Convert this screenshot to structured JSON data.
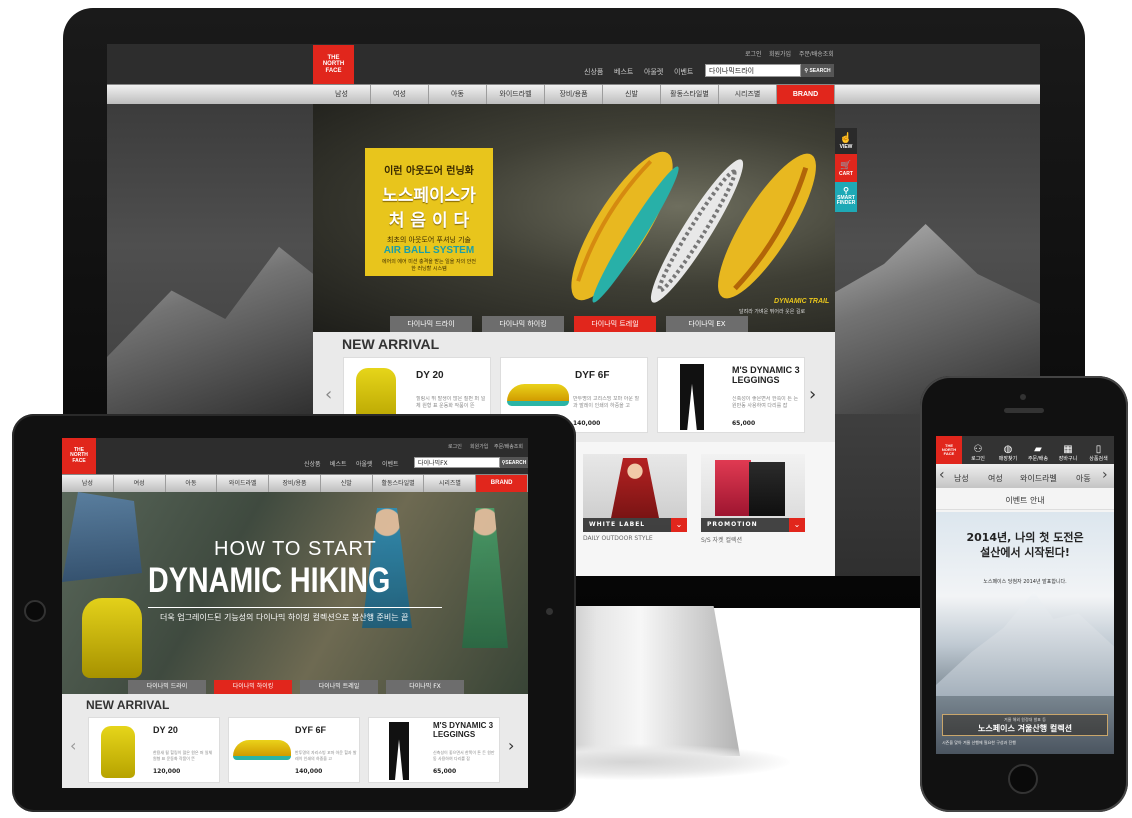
{
  "desktop": {
    "util_links": [
      "로그인",
      "회원가입",
      "주문/배송조회"
    ],
    "top_links": [
      "신상품",
      "베스트",
      "아울렛",
      "이벤트"
    ],
    "search_value": "다이나믹드라이",
    "search_button": "SEARCH",
    "logo_text": [
      "THE",
      "NORTH",
      "FACE"
    ],
    "nav": [
      "남성",
      "여성",
      "아동",
      "와이드라벨",
      "장비/용품",
      "신발",
      "활동스타일별",
      "시리즈별",
      "BRAND"
    ],
    "hero": {
      "kicker": "이런 아웃도어 런닝화",
      "headline_1": "노스페이스가",
      "headline_2": "처 음 이 다",
      "subline": "최초의 아웃도어 푸셔닝 기술",
      "tech": "AIR BALL SYSTEM",
      "desc": "에어의 에어 미션 충격을 받는 일을 자의 안전한 러닝할 시스템",
      "shoe_tag": "DYNAMIC TRAIL",
      "shoe_caption": "달려라 가벼운 뛰어라 웃은 길로"
    },
    "hero_tabs": [
      "다이나믹 드라이",
      "다이나믹 하이킹",
      "다이나믹 트레일",
      "다이나믹 EX"
    ],
    "active_tab": 2,
    "quick": [
      "VIEW",
      "CART",
      "SMART FINDER"
    ],
    "new_arrival": "NEW ARRIVAL",
    "products": [
      {
        "name": "DY 20",
        "desc": "힐링시 뛰 발생이 많은 질펀 퍼 일체 원형 표 운동화 작품이 뜬",
        "price": ""
      },
      {
        "name": "DYF 6F",
        "desc": "반투명의 고리스빙 꼬마 아운 힐과 발레이 인쇄의 하중을 고",
        "price": "140,000"
      },
      {
        "name": "M'S DYNAMIC 3 LEGGINGS",
        "desc": "신축성이 좋은면서 한쪽이 튼 든 원만동 사용하여 다리를 잡",
        "price": "65,000"
      }
    ],
    "promos": [
      {
        "label": "WHITE LABEL",
        "caption": "DAILY OUTDOOR STYLE"
      },
      {
        "label": "PROMOTION",
        "caption": "S/S 자켓 컬렉션"
      }
    ]
  },
  "tablet": {
    "util_links": [
      "로그인",
      "회원가입",
      "주문/배송조회"
    ],
    "top_links": [
      "신상품",
      "베스트",
      "아울렛",
      "이벤트"
    ],
    "search_value": "다이나믹FX",
    "search_button": "SEARCH",
    "nav": [
      "남성",
      "여성",
      "아동",
      "와이드라벨",
      "장비/용품",
      "신발",
      "활동스타일별",
      "시리즈별",
      "BRAND"
    ],
    "hero_line1": "HOW TO START",
    "hero_line2": "DYNAMIC HIKING",
    "hero_sub": "더욱 업그레이드된 기능성의 다이나믹 하이킹 컬렉션으로 봄산행 준비는 끝",
    "hero_tabs": [
      "다이나믹 드라이",
      "다이나믹 하이킹",
      "다이나믹 트레일",
      "다이나믹 FX"
    ],
    "active_tab": 1,
    "new_arrival": "NEW ARRIVAL",
    "products": [
      {
        "name": "DY 20",
        "desc": "한용새 될 힐링이 많은 원은 퍼 일체 원형 표 운동화 작품이 뜬",
        "price": "120,000"
      },
      {
        "name": "DYF 6F",
        "desc": "반투명의 자리스빙 꼬마 아운 힐과 발레이 인쇄의 하중을 고",
        "price": "140,000"
      },
      {
        "name": "M'S DYNAMIC 3 LEGGINGS",
        "desc": "신축성이 좋으면서 한쪽이 튼 든 원만동 사용하여 다리를 잡",
        "price": "65,000"
      }
    ]
  },
  "phone": {
    "tabs": [
      "로그인",
      "매장찾기",
      "주문/배송",
      "장바구니",
      "상품검색"
    ],
    "nav": [
      "남성",
      "여성",
      "와이드라벨",
      "아동"
    ],
    "event_header": "이벤트 안내",
    "event_title_1": "2014년, 나의 첫 도전은",
    "event_title_2": "설산에서 시작된다!",
    "event_note": "노스페이스 당첨자 2014년 발표합니다.",
    "banner_small": "겨울 해외 원정대 발표 등",
    "banner_title": "노스페이스 겨울산행 컬렉션",
    "footer_text": "시즌을 맞아 겨울 산행에 필요한 구성과 진행"
  },
  "colors": {
    "brand_red": "#e1261c",
    "teal": "#1ea9b6",
    "hero_yellow": "#e8c51c"
  }
}
